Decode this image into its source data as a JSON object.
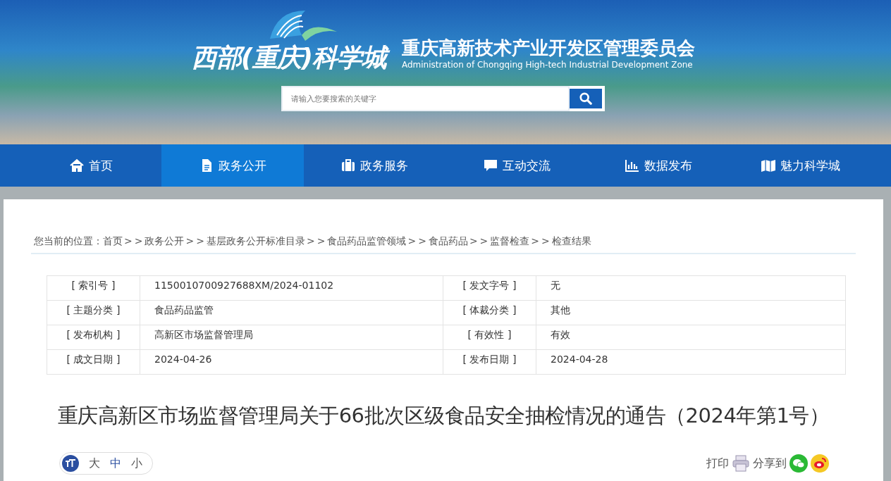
{
  "header": {
    "logo_text": "西部(重庆)科学城",
    "title": "重庆高新技术产业开发区管理委员会",
    "subtitle": "Administration of Chongqing High-tech Industrial Development Zone",
    "search": {
      "placeholder": "请输入您要搜索的关键字"
    }
  },
  "nav": [
    {
      "label": "首页",
      "selected": false
    },
    {
      "label": "政务公开",
      "selected": true
    },
    {
      "label": "政务服务",
      "selected": false
    },
    {
      "label": "互动交流",
      "selected": false
    },
    {
      "label": "数据发布",
      "selected": false
    },
    {
      "label": "魅力科学城",
      "selected": false
    }
  ],
  "breadcrumb": {
    "prefix": "您当前的位置：",
    "separator": ">>",
    "items": [
      "首页",
      "政务公开",
      "基层政务公开标准目录",
      "食品药品监管领域",
      "食品药品",
      "监督检查",
      "检查结果"
    ]
  },
  "info_table": [
    [
      {
        "label": "[ 索引号 ]",
        "value": "1150010700927688XM/2024-01102"
      },
      {
        "label": "[ 发文字号 ]",
        "value": "无"
      }
    ],
    [
      {
        "label": "[ 主题分类 ]",
        "value": "食品药品监管"
      },
      {
        "label": "[ 体裁分类 ]",
        "value": "其他"
      }
    ],
    [
      {
        "label": "[ 发布机构 ]",
        "value": "高新区市场监督管理局"
      },
      {
        "label": "[ 有效性 ]",
        "value": "有效"
      }
    ],
    [
      {
        "label": "[ 成文日期 ]",
        "value": "2024-04-26"
      },
      {
        "label": "[ 发布日期 ]",
        "value": "2024-04-28"
      }
    ]
  ],
  "article_title": "重庆高新区市场监督管理局关于66批次区级食品安全抽检情况的通告（2024年第1号）",
  "font_sizes": [
    {
      "label": "大",
      "selected": false
    },
    {
      "label": "中",
      "selected": true
    },
    {
      "label": "小",
      "selected": false
    }
  ],
  "tools": {
    "print": "打印",
    "share": "分享到"
  }
}
